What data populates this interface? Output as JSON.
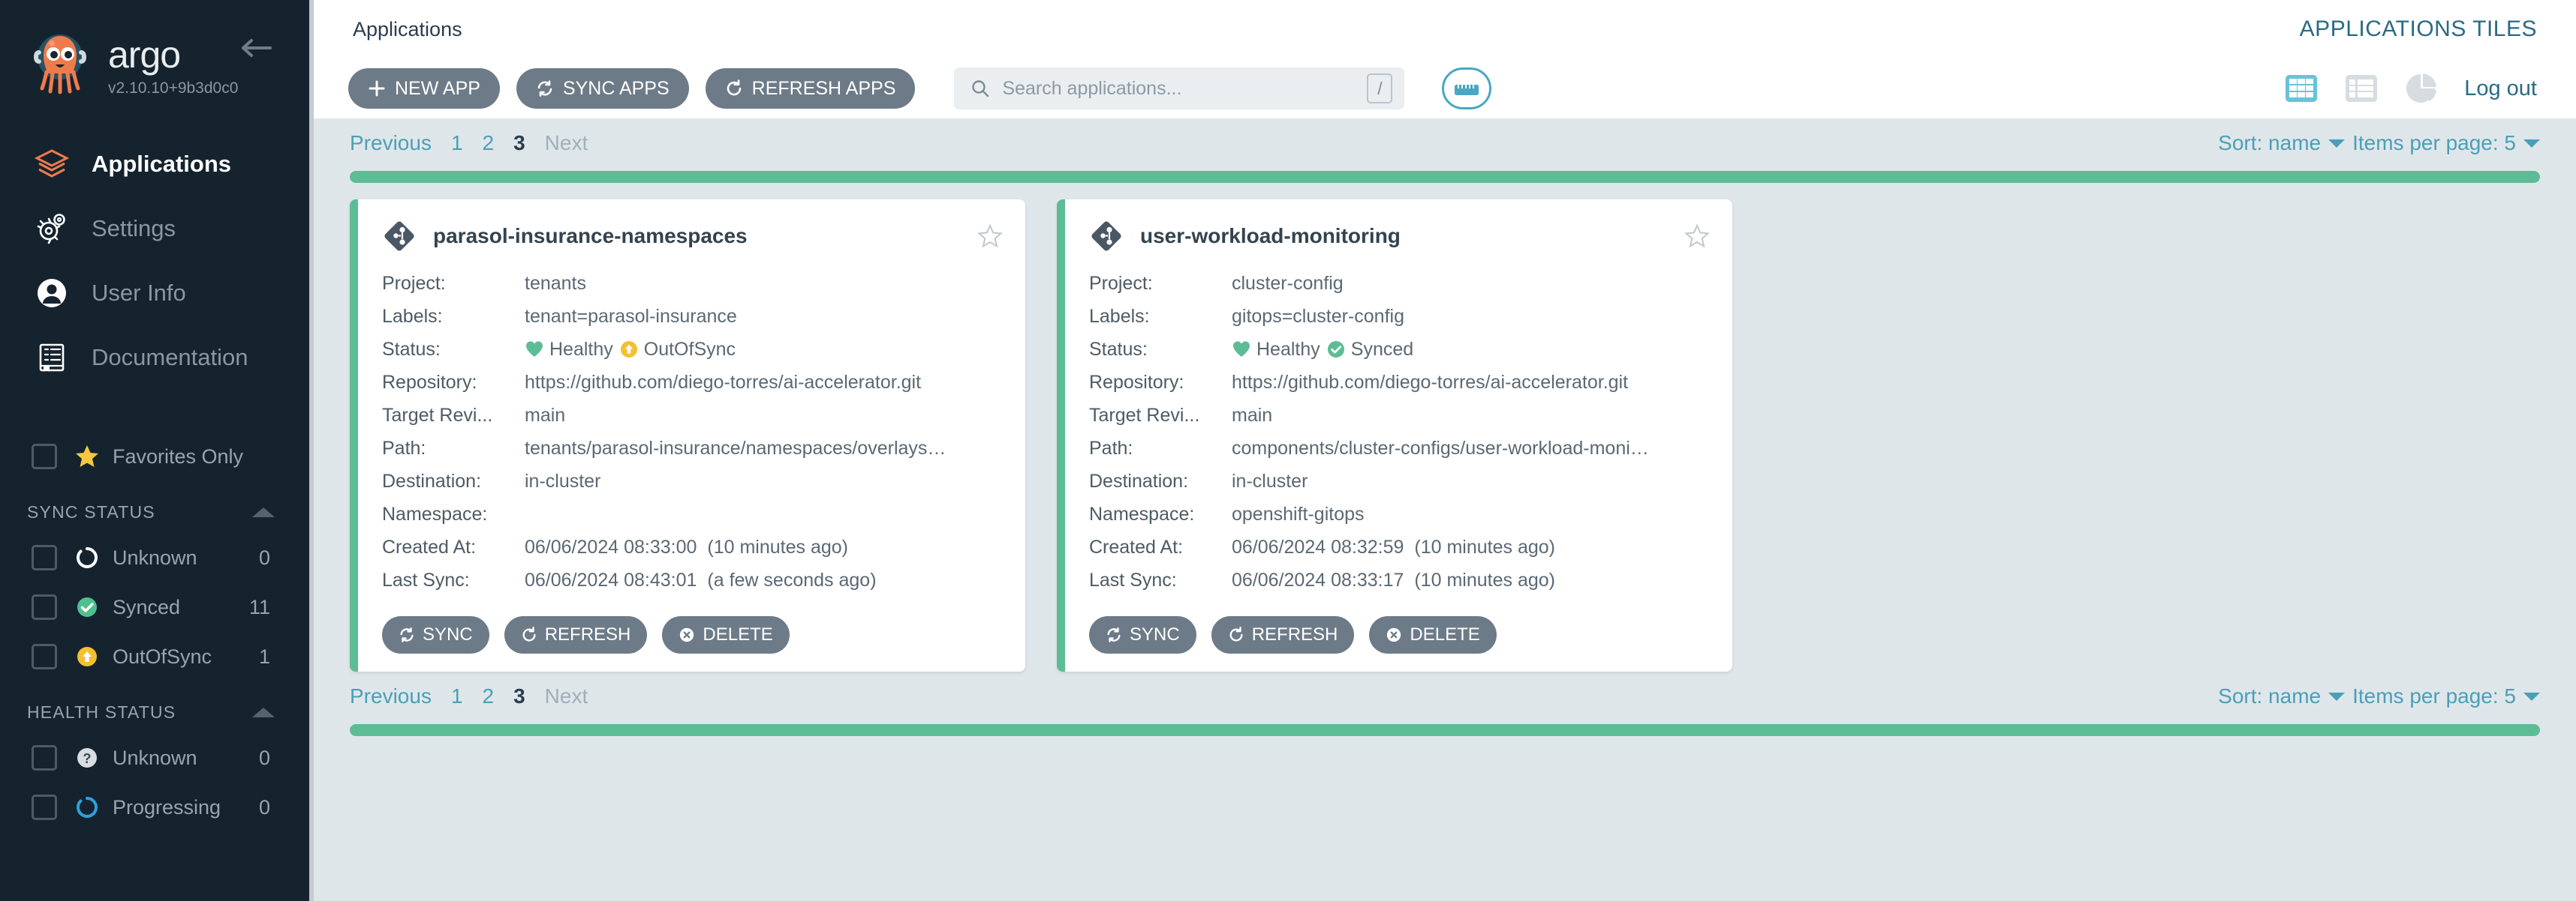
{
  "sidebar": {
    "brand": {
      "name": "argo",
      "version": "v2.10.10+9b3d0c0"
    },
    "collapse_label": "collapse-sidebar",
    "nav": [
      {
        "label": "Applications",
        "icon": "layers-icon",
        "active": true
      },
      {
        "label": "Settings",
        "icon": "gear-icon",
        "active": false
      },
      {
        "label": "User Info",
        "icon": "user-icon",
        "active": false
      },
      {
        "label": "Documentation",
        "icon": "book-icon",
        "active": false
      }
    ],
    "favorites": {
      "label": "Favorites Only",
      "icon": "star-icon",
      "checked": false
    },
    "sync_status": {
      "title": "SYNC STATUS",
      "items": [
        {
          "label": "Unknown",
          "count": "0",
          "icon": "unknown-circle-icon",
          "checked": false
        },
        {
          "label": "Synced",
          "count": "11",
          "icon": "synced-check-icon",
          "checked": false
        },
        {
          "label": "OutOfSync",
          "count": "1",
          "icon": "outofsync-arrow-icon",
          "checked": false
        }
      ]
    },
    "health_status": {
      "title": "HEALTH STATUS",
      "items": [
        {
          "label": "Unknown",
          "count": "0",
          "icon": "question-circle-icon",
          "checked": false
        },
        {
          "label": "Progressing",
          "count": "0",
          "icon": "progressing-circle-icon",
          "checked": false
        }
      ]
    }
  },
  "header": {
    "breadcrumb": "Applications",
    "tiles_title": "APPLICATIONS TILES"
  },
  "toolbar": {
    "new_app": "NEW APP",
    "sync_apps": "SYNC APPS",
    "refresh_apps": "REFRESH APPS",
    "search_placeholder": "Search applications...",
    "search_value": "",
    "search_shortcut": "/",
    "keyboard_button": "keyboard-shortcuts",
    "logout": "Log out",
    "views": [
      "tiles-view-icon",
      "list-view-icon",
      "summary-pie-icon"
    ],
    "active_view": "tiles-view-icon"
  },
  "pagination": {
    "previous": "Previous",
    "next": "Next",
    "pages": [
      "1",
      "2",
      "3"
    ],
    "current": "3",
    "sort_label": "Sort: name",
    "items_per_page_label": "Items per page: 5"
  },
  "progress": {
    "percent": 100,
    "color": "#5cbc96"
  },
  "labels": {
    "project": "Project:",
    "labels": "Labels:",
    "status": "Status:",
    "repository": "Repository:",
    "target_revision": "Target Revi...",
    "path": "Path:",
    "destination": "Destination:",
    "namespace": "Namespace:",
    "created_at": "Created At:",
    "last_sync": "Last Sync:",
    "sync": "SYNC",
    "refresh": "REFRESH",
    "delete": "DELETE"
  },
  "applications": [
    {
      "name": "parasol-insurance-namespaces",
      "project": "tenants",
      "app_labels": "tenant=parasol-insurance",
      "health": "Healthy",
      "sync": "OutOfSync",
      "sync_icon": "outofsync-arrow-icon",
      "repository": "https://github.com/diego-torres/ai-accelerator.git",
      "target_revision": "main",
      "path": "tenants/parasol-insurance/namespaces/overlays…",
      "destination": "in-cluster",
      "namespace": "",
      "created_at": "06/06/2024 08:33:00",
      "created_rel": "(10 minutes ago)",
      "last_sync": "06/06/2024 08:43:01",
      "last_sync_rel": "(a few seconds ago)",
      "favorite": false
    },
    {
      "name": "user-workload-monitoring",
      "project": "cluster-config",
      "app_labels": "gitops=cluster-config",
      "health": "Healthy",
      "sync": "Synced",
      "sync_icon": "synced-check-icon",
      "repository": "https://github.com/diego-torres/ai-accelerator.git",
      "target_revision": "main",
      "path": "components/cluster-configs/user-workload-moni…",
      "destination": "in-cluster",
      "namespace": "openshift-gitops",
      "created_at": "06/06/2024 08:32:59",
      "created_rel": "(10 minutes ago)",
      "last_sync": "06/06/2024 08:33:17",
      "last_sync_rel": "(10 minutes ago)",
      "favorite": false
    }
  ],
  "colors": {
    "sidebar_bg": "#15232f",
    "accent_orange": "#ef7b4d",
    "healthy_green": "#5cbc96",
    "outofsync_yellow": "#f4c030",
    "link_teal": "#4a9fb8",
    "title_blue": "#2a6a85"
  }
}
